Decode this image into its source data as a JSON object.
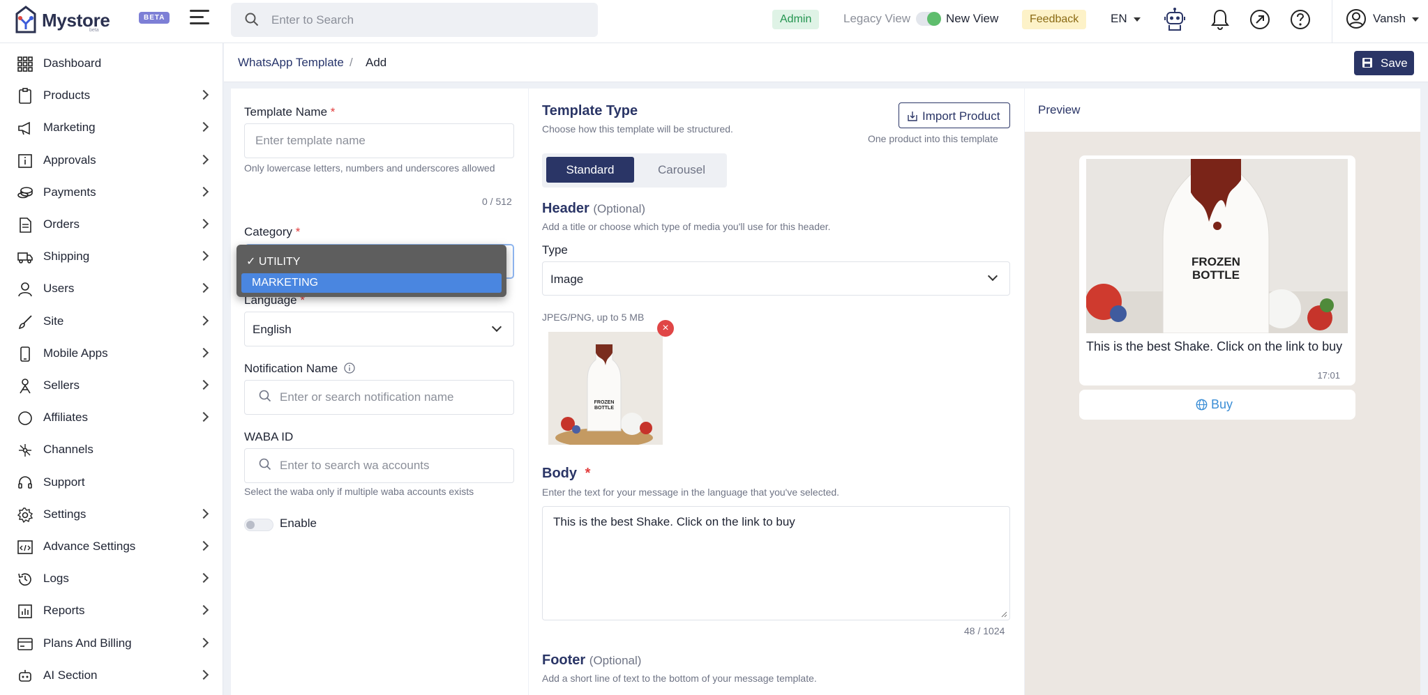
{
  "header": {
    "brand": "Mystore",
    "brand_sub": "beta",
    "beta_badge": "BETA",
    "search_placeholder": "Enter to Search",
    "admin_badge": "Admin",
    "legacy_view": "Legacy View",
    "new_view": "New View",
    "feedback": "Feedback",
    "language": "EN",
    "user_name": "Vansh"
  },
  "sidebar": {
    "items": [
      {
        "label": "Dashboard",
        "icon": "grid-icon",
        "chevron": false
      },
      {
        "label": "Products",
        "icon": "clipboard-icon",
        "chevron": true
      },
      {
        "label": "Marketing",
        "icon": "megaphone-icon",
        "chevron": true
      },
      {
        "label": "Approvals",
        "icon": "info-box-icon",
        "chevron": true
      },
      {
        "label": "Payments",
        "icon": "coins-icon",
        "chevron": true
      },
      {
        "label": "Orders",
        "icon": "document-icon",
        "chevron": true
      },
      {
        "label": "Shipping",
        "icon": "truck-icon",
        "chevron": true
      },
      {
        "label": "Users",
        "icon": "user-icon",
        "chevron": true
      },
      {
        "label": "Site",
        "icon": "brush-icon",
        "chevron": true
      },
      {
        "label": "Mobile Apps",
        "icon": "phone-icon",
        "chevron": true
      },
      {
        "label": "Sellers",
        "icon": "seller-icon",
        "chevron": true
      },
      {
        "label": "Affiliates",
        "icon": "circle-icon",
        "chevron": true
      },
      {
        "label": "Channels",
        "icon": "network-icon",
        "chevron": false
      },
      {
        "label": "Support",
        "icon": "headset-icon",
        "chevron": false
      },
      {
        "label": "Settings",
        "icon": "gear-icon",
        "chevron": true
      },
      {
        "label": "Advance Settings",
        "icon": "code-icon",
        "chevron": true
      },
      {
        "label": "Logs",
        "icon": "history-icon",
        "chevron": true
      },
      {
        "label": "Reports",
        "icon": "report-icon",
        "chevron": true
      },
      {
        "label": "Plans And Billing",
        "icon": "billing-icon",
        "chevron": true
      },
      {
        "label": "AI Section",
        "icon": "robot-icon",
        "chevron": true
      }
    ]
  },
  "breadcrumb": {
    "parent": "WhatsApp Template",
    "separator": "/",
    "current": "Add",
    "save": "Save"
  },
  "form": {
    "template_name_label": "Template Name",
    "required_mark": "*",
    "template_name_placeholder": "Enter template name",
    "template_name_help": "Only lowercase letters, numbers and underscores allowed",
    "template_name_counter": "0 / 512",
    "category_label": "Category",
    "category_options": [
      "UTILITY",
      "MARKETING"
    ],
    "category_check": "✓",
    "language_label": "Language",
    "language_value": "English",
    "notification_label": "Notification Name",
    "notification_placeholder": "Enter or search notification name",
    "waba_label": "WABA ID",
    "waba_placeholder": "Enter to search wa accounts",
    "waba_help": "Select the waba only if multiple waba accounts exists",
    "enable_label": "Enable"
  },
  "template": {
    "type_title": "Template Type",
    "type_sub": "Choose how this template will be structured.",
    "import_button": "Import Product",
    "import_sub": "One product into this template",
    "seg_standard": "Standard",
    "seg_carousel": "Carousel",
    "header_title": "Header",
    "optional": "(Optional)",
    "header_sub": "Add a title or choose which type of media you'll use for this header.",
    "type_label": "Type",
    "type_value": "Image",
    "media_hint": "JPEG/PNG, up to 5 MB",
    "remove": "×",
    "body_title": "Body",
    "body_sub": "Enter the text for your message in the language that you've selected.",
    "body_value": "This is the best Shake. Click on the link to buy",
    "body_counter": "48 / 1024",
    "footer_title": "Footer",
    "footer_sub": "Add a short line of text to the bottom of your message template."
  },
  "preview": {
    "title": "Preview",
    "message": "This is the best Shake. Click on the link to buy",
    "time": "17:01",
    "button": "Buy",
    "bottle_label_1": "FROZEN",
    "bottle_label_2": "BOTTLE"
  }
}
